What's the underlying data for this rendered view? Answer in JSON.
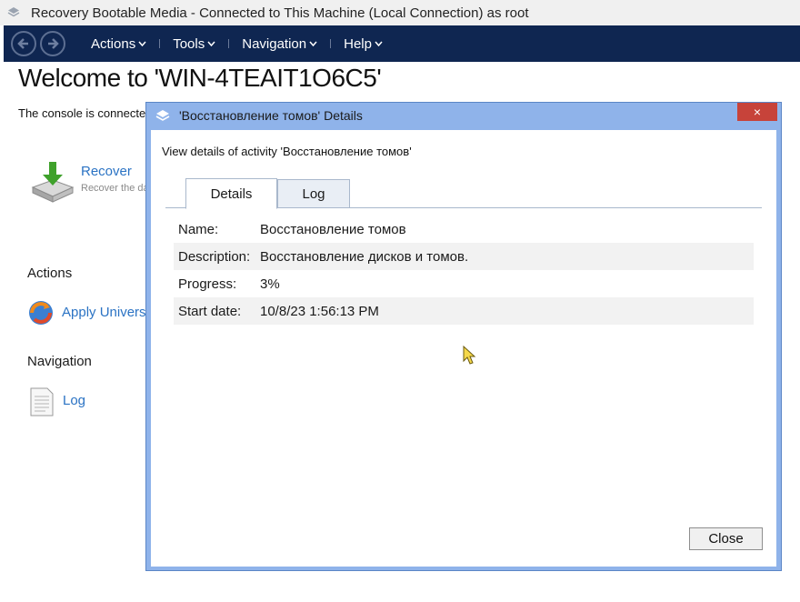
{
  "app": {
    "title": "Recovery Bootable Media - Connected to This Machine (Local Connection) as root",
    "icon": "layers-icon"
  },
  "toolbar": {
    "back_icon": "back-arrow-icon",
    "forward_icon": "forward-arrow-icon",
    "menus": [
      {
        "label": "Actions"
      },
      {
        "label": "Tools"
      },
      {
        "label": "Navigation"
      },
      {
        "label": "Help"
      }
    ],
    "chevron": "⌄",
    "bg_color": "#0f2651"
  },
  "main": {
    "title": "Welcome to 'WIN-4TEAIT1O6C5'",
    "subtitle": "The console is connected",
    "recover": {
      "label": "Recover",
      "description": "Recover the da",
      "icon": "disk-download-icon"
    },
    "actions_heading": "Actions",
    "apply_universal": {
      "label": "Apply Univers",
      "icon": "universal-restore-icon"
    },
    "navigation_heading": "Navigation",
    "log": {
      "label": "Log",
      "icon": "document-icon"
    },
    "link_color": "#2b73c4"
  },
  "dialog": {
    "title": "'Восстановление томов' Details",
    "close_x": "×",
    "description": "View details of activity 'Восстановление томов'",
    "tabs": [
      {
        "label": "Details",
        "active": true
      },
      {
        "label": "Log",
        "active": false
      }
    ],
    "details": [
      {
        "label": "Name:",
        "value": "Восстановление томов"
      },
      {
        "label": "Description:",
        "value": "Восстановление дисков и томов."
      },
      {
        "label": "Progress:",
        "value": "3%"
      },
      {
        "label": "Start date:",
        "value": "10/8/23 1:56:13 PM"
      }
    ],
    "close_button": "Close",
    "frame_color": "#8fb3ea",
    "close_x_color": "#c7433a"
  }
}
